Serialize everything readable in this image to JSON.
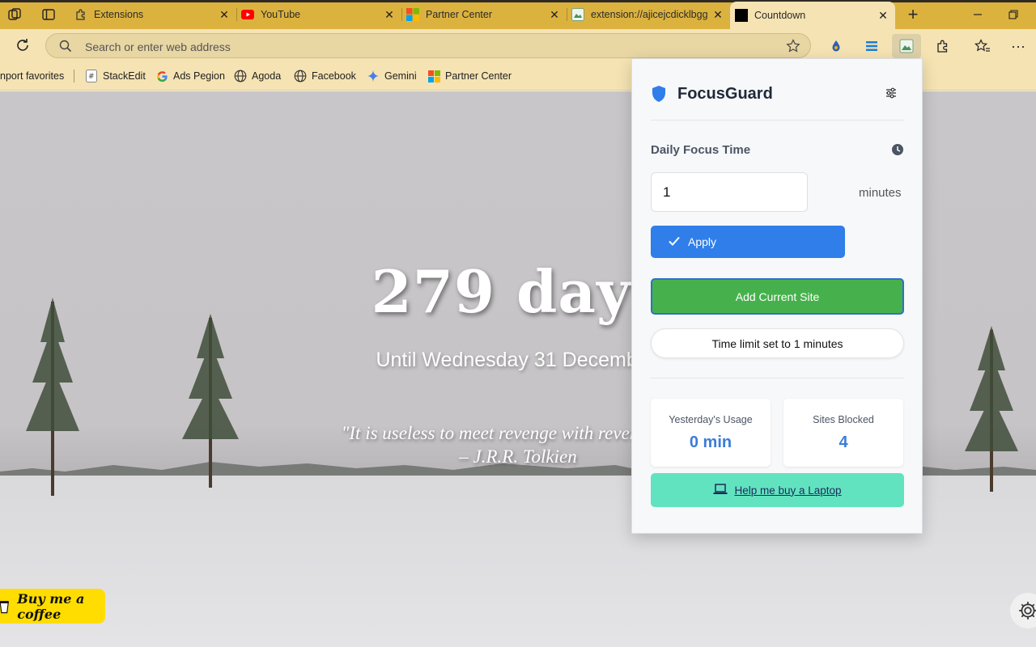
{
  "browser": {
    "tabs": [
      {
        "title": "Extensions"
      },
      {
        "title": "YouTube"
      },
      {
        "title": "Partner Center"
      },
      {
        "title": "extension://ajicejcdicklbgg"
      },
      {
        "title": "Countdown",
        "active": true
      }
    ],
    "address_placeholder": "Search or enter web address",
    "favorites": [
      "nport favorites",
      "StackEdit",
      "Ads Pegion",
      "Agoda",
      "Facebook",
      "Gemini",
      "Partner Center"
    ]
  },
  "countdown": {
    "big": "279 days",
    "sub": "Until Wednesday 31 December,",
    "quote_line1": "\"It is useless to meet revenge with revenge; it w",
    "quote_line2": "– J.R.R. Tolkien"
  },
  "buy_coffee": "Buy me a coffee",
  "popup": {
    "title": "FocusGuard",
    "section_label": "Daily Focus Time",
    "input_value": "1",
    "unit": "minutes",
    "apply_label": "Apply",
    "add_site_label": "Add Current Site",
    "status_text": "Time limit set to 1 minutes",
    "stats": [
      {
        "label": "Yesterday's Usage",
        "value": "0 min"
      },
      {
        "label": "Sites Blocked",
        "value": "4"
      }
    ],
    "laptop_label": "Help me buy a Laptop",
    "accent": "#2f7eea",
    "green": "#46b14c",
    "teal": "#62e3bf"
  }
}
